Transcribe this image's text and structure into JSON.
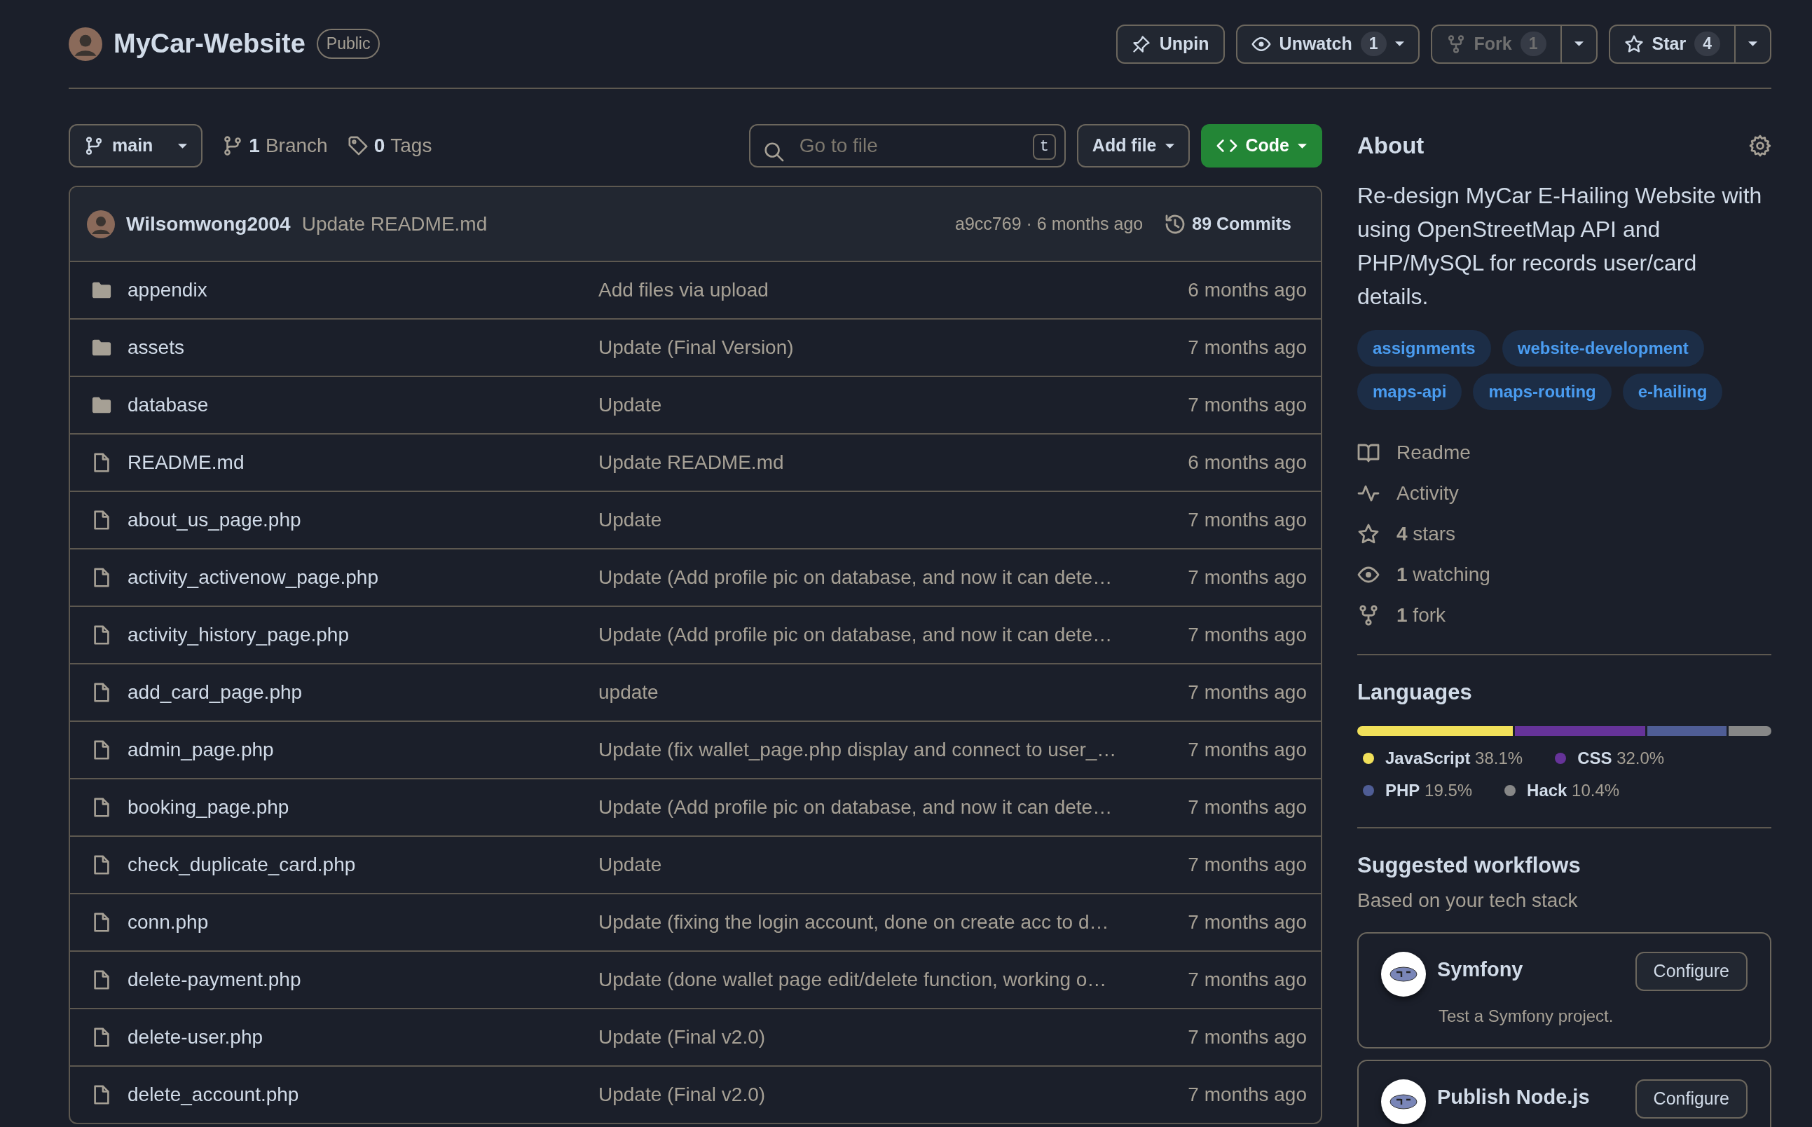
{
  "repo": {
    "name": "MyCar-Website",
    "visibility": "Public"
  },
  "actions": [
    {
      "kind": "pin",
      "label": "Unpin",
      "disabled": false
    },
    {
      "kind": "watch",
      "label": "Unwatch",
      "count": "1",
      "disabled": false
    },
    {
      "kind": "fork",
      "label": "Fork",
      "count": "1",
      "disabled": true
    },
    {
      "kind": "star",
      "label": "Star",
      "count": "4",
      "disabled": false
    }
  ],
  "branch": {
    "name": "main"
  },
  "branch_links": [
    {
      "kind": "branch",
      "count": "1",
      "label": "Branch"
    },
    {
      "kind": "tag",
      "count": "0",
      "label": "Tags"
    }
  ],
  "search": {
    "placeholder": "Go to file",
    "shortcut": "t"
  },
  "add_file": "Add file",
  "code": "Code",
  "last_commit": {
    "author": "Wilsomwong2004",
    "message": "Update README.md",
    "meta": "a9cc769 · 6 months ago",
    "commits": "89 Commits"
  },
  "files": [
    {
      "kind": "folder",
      "name": "appendix",
      "message": "Add files via upload",
      "time": "6 months ago"
    },
    {
      "kind": "folder",
      "name": "assets",
      "message": "Update (Final Version)",
      "time": "7 months ago"
    },
    {
      "kind": "folder",
      "name": "database",
      "message": "Update",
      "time": "7 months ago"
    },
    {
      "kind": "file",
      "name": "README.md",
      "message": "Update README.md",
      "time": "6 months ago"
    },
    {
      "kind": "file",
      "name": "about_us_page.php",
      "message": "Update",
      "time": "7 months ago"
    },
    {
      "kind": "file",
      "name": "activity_activenow_page.php",
      "message": "Update (Add profile pic on database, and now it can dete…",
      "time": "7 months ago"
    },
    {
      "kind": "file",
      "name": "activity_history_page.php",
      "message": "Update (Add profile pic on database, and now it can dete…",
      "time": "7 months ago"
    },
    {
      "kind": "file",
      "name": "add_card_page.php",
      "message": "update",
      "time": "7 months ago"
    },
    {
      "kind": "file",
      "name": "admin_page.php",
      "message": "Update (fix wallet_page.php display and connect to user_…",
      "time": "7 months ago"
    },
    {
      "kind": "file",
      "name": "booking_page.php",
      "message": "Update (Add profile pic on database, and now it can dete…",
      "time": "7 months ago"
    },
    {
      "kind": "file",
      "name": "check_duplicate_card.php",
      "message": "Update",
      "time": "7 months ago"
    },
    {
      "kind": "file",
      "name": "conn.php",
      "message": "Update (fixing the login account, done on create acc to d…",
      "time": "7 months ago"
    },
    {
      "kind": "file",
      "name": "delete-payment.php",
      "message": "Update (done wallet page edit/delete function, working o…",
      "time": "7 months ago"
    },
    {
      "kind": "file",
      "name": "delete-user.php",
      "message": "Update (Final v2.0)",
      "time": "7 months ago"
    },
    {
      "kind": "file",
      "name": "delete_account.php",
      "message": "Update (Final v2.0)",
      "time": "7 months ago"
    }
  ],
  "about": {
    "title": "About",
    "description": "Re-design MyCar E-Hailing Website with using OpenStreetMap API and PHP/MySQL for records user/card details.",
    "topics": [
      "assignments",
      "website-development",
      "maps-api",
      "maps-routing",
      "e-hailing"
    ],
    "links": [
      {
        "kind": "book",
        "text": "Readme"
      },
      {
        "kind": "pulse",
        "text": "Activity"
      },
      {
        "kind": "star",
        "text": "**4** stars"
      },
      {
        "kind": "eye",
        "text": "**1** watching"
      },
      {
        "kind": "fork",
        "text": "**1** fork"
      }
    ]
  },
  "languages": {
    "title": "Languages",
    "items": [
      {
        "name": "JavaScript",
        "percent": "38.1%",
        "color": "#f1e05a"
      },
      {
        "name": "CSS",
        "percent": "32.0%",
        "color": "#663399"
      },
      {
        "name": "PHP",
        "percent": "19.5%",
        "color": "#4f5d95"
      },
      {
        "name": "Hack",
        "percent": "10.4%",
        "color": "#878787"
      }
    ]
  },
  "workflows": {
    "title": "Suggested workflows",
    "subtitle": "Based on your tech stack",
    "cards": [
      {
        "name": "Symfony",
        "description": "Test a Symfony project.",
        "button": "Configure"
      },
      {
        "name": "Publish Node.js",
        "button": "Configure"
      }
    ]
  }
}
